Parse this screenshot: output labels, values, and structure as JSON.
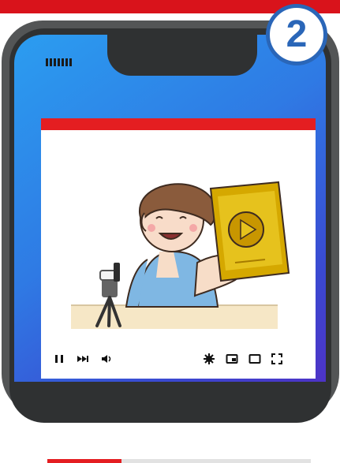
{
  "badge": {
    "number": "2"
  },
  "player": {
    "progress_fraction": 0.28,
    "controls": [
      "pause-icon",
      "next-icon",
      "volume-icon",
      "settings-icon",
      "miniplayer-icon",
      "theater-icon",
      "fullscreen-icon"
    ]
  },
  "colors": {
    "top_bar": "#d9131b",
    "player_accent": "#e41e21",
    "badge_border": "#2a66b8",
    "screen_gradient_start": "#2b9df0",
    "screen_gradient_end": "#4d33c6"
  }
}
